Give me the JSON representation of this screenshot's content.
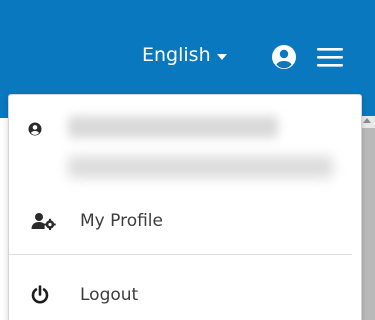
{
  "navbar": {
    "background": "#0a78bf",
    "language_label": "English",
    "user_icon": "user-circle-icon",
    "menu_icon": "hamburger-menu-icon"
  },
  "dropdown": {
    "user_icon": "user-circle-icon",
    "items": [
      {
        "label": "My Profile",
        "icon": "user-cog-icon"
      },
      {
        "label": "Logout",
        "icon": "power-icon"
      }
    ]
  }
}
